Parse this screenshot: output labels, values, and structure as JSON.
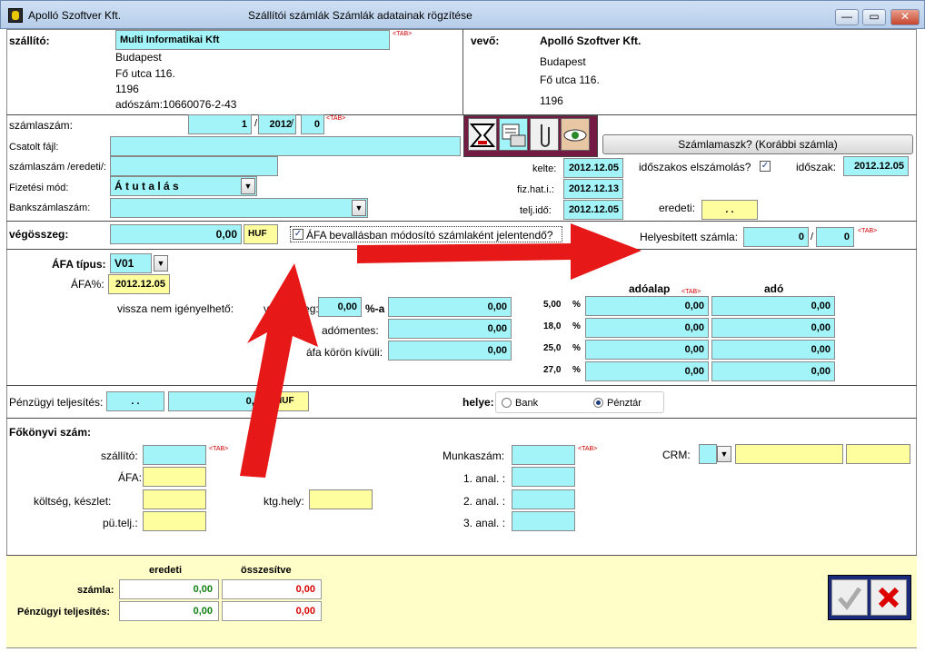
{
  "window": {
    "app": "Apolló Szoftver Kft.",
    "title": "Szállítói számlák Számlák adatainak rögzítése",
    "min": "—",
    "max": "▭",
    "close": "✕"
  },
  "tab": "<TAB>",
  "supplier": {
    "label": "szállító:",
    "name": "Multi Informatikai Kft",
    "city": "Budapest",
    "street": "Fő utca 116.",
    "zip": "1196",
    "tax": "adószám:10660076-2-43"
  },
  "buyer": {
    "label": "vevő:",
    "name": "Apolló Szoftver Kft.",
    "city": "Budapest",
    "street": "Fő utca 116.",
    "zip": "1196"
  },
  "invoice": {
    "number_label": "számlaszám:",
    "number": "1",
    "slash": "/",
    "year": "2012",
    "seq": "0",
    "attached_label": "Csatolt fájl:",
    "original_label": "számlaszám /eredeti/:",
    "payment_label": "Fizetési mód:",
    "payment": "Á t u t a l á s",
    "bank_label": "Bankszámlaszám:",
    "mask_button": "Számlamaszk?  (Korábbi számla)",
    "date_label": "kelte:",
    "date": "2012.12.05",
    "due_label": "fiz.hat.i.:",
    "due": "2012.12.13",
    "perf_label": "telj.idő:",
    "perf": "2012.12.05",
    "periodic_label": "időszakos elszámolás?",
    "period_label": "időszak:",
    "period": "2012.12.05",
    "orig_label": "eredeti:",
    "orig": ". .",
    "total_label": "végösszeg:",
    "total": "0,00",
    "currency": "HUF",
    "vat_modify_label": "ÁFA bevallásban módosító számlaként jelentendő?",
    "replaced_label": "Helyesbített számla:",
    "replaced_a": "0",
    "replaced_b": "0"
  },
  "vat": {
    "type_label": "ÁFA típus:",
    "type": "V01",
    "pct_label": "ÁFA%:",
    "pct_date": "2012.12.05",
    "nonclaim_label": "vissza nem igényelhető:",
    "final_label": "végösszeg:",
    "final_pct": "0,00",
    "pct_a": "%-a",
    "nonclaim_value": "0,00",
    "exempt_label": "adómentes:",
    "exempt": "0,00",
    "outside_label": "áfa körön kívüli:",
    "outside": "0,00",
    "base_header": "adóalap",
    "tax_header": "adó",
    "rates": [
      {
        "rate": "5,00",
        "sign": "%",
        "base": "0,00",
        "tax": "0,00"
      },
      {
        "rate": "18,0",
        "sign": "%",
        "base": "0,00",
        "tax": "0,00"
      },
      {
        "rate": "25,0",
        "sign": "%",
        "base": "0,00",
        "tax": "0,00"
      },
      {
        "rate": "27,0",
        "sign": "%",
        "base": "0,00",
        "tax": "0,00"
      }
    ]
  },
  "payment": {
    "label": "Pénzügyi teljesítés:",
    "date": ". .",
    "amount": "0,00",
    "currency": "HUF",
    "place_label": "helye:",
    "bank": "Bank",
    "cash": "Pénztár",
    "selected": "Pénztár"
  },
  "ledger": {
    "title": "Főkönyvi szám:",
    "supplier": "szállító:",
    "vat": "ÁFA:",
    "cost": "költség, készlet:",
    "fin": "pü.telj.:",
    "cc": "ktg.hely:",
    "job": "Munkaszám:",
    "a1": "1. anal. :",
    "a2": "2. anal. :",
    "a3": "3. anal. :",
    "crm": "CRM:"
  },
  "summary": {
    "orig_header": "eredeti",
    "total_header": "összesítve",
    "inv_label": "számla:",
    "inv_orig": "0,00",
    "inv_total": "0,00",
    "fin_label": "Pénzügyi teljesítés:",
    "fin_orig": "0,00",
    "fin_total": "0,00"
  },
  "colors": {
    "cyan": "#a2f4f8",
    "yellow": "#fffe9e",
    "arrow": "#e61818",
    "green": "#118011",
    "red": "#d80000"
  }
}
